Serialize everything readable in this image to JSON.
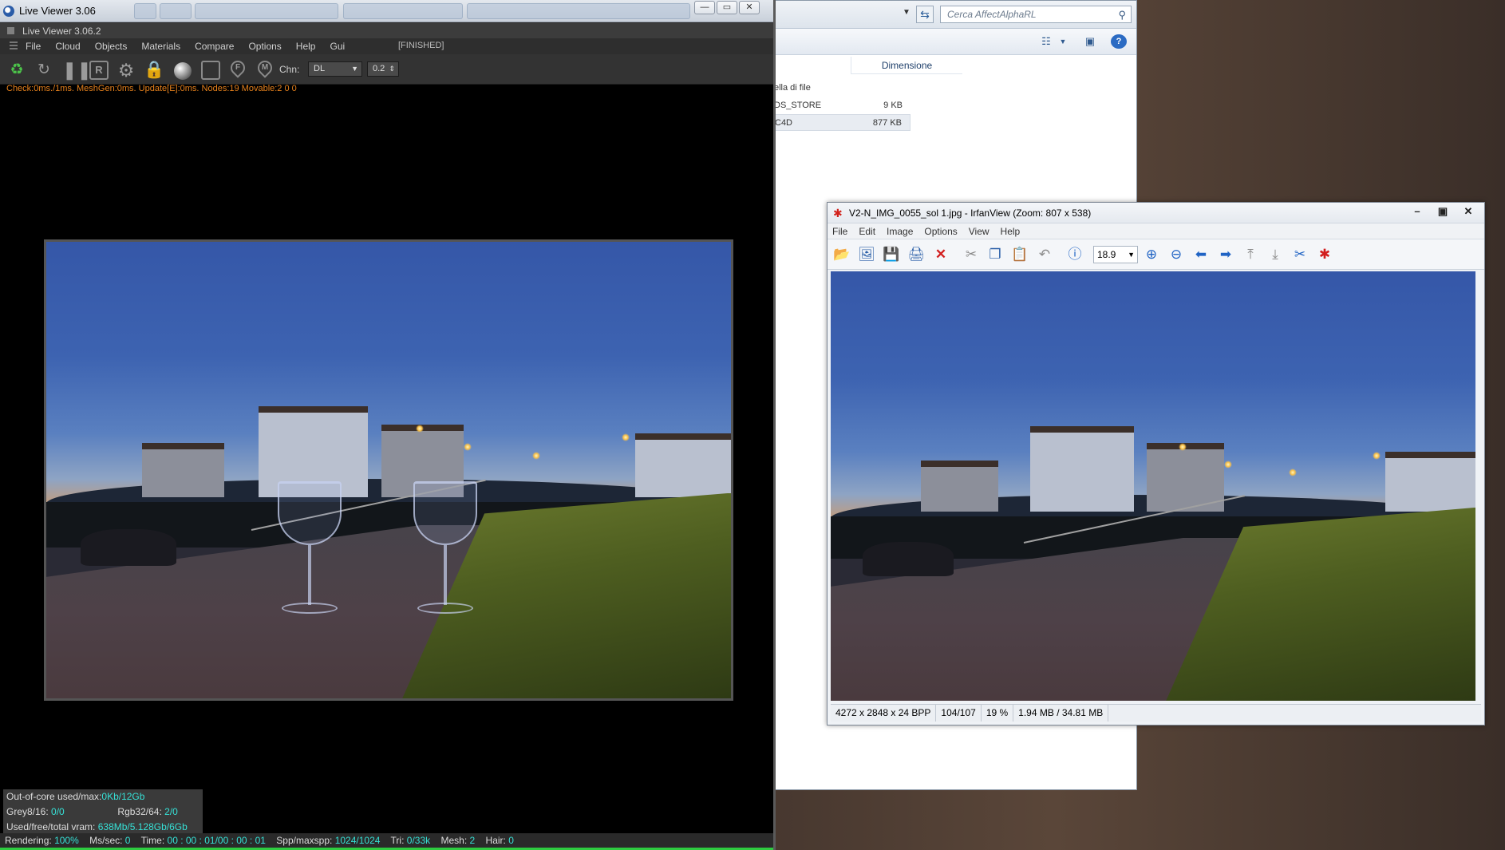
{
  "explorer": {
    "search_placeholder": "Cerca AffectAlphaRL",
    "column_header": "Dimensione",
    "partial_label": "ella di file",
    "files": [
      {
        "name": "DS_STORE",
        "size": "9 KB"
      },
      {
        "name": "C4D",
        "size": "877 KB"
      }
    ]
  },
  "liveviewer": {
    "window_title": "Live Viewer 3.06",
    "subtitle": "Live Viewer 3.06.2",
    "menu": [
      "File",
      "Cloud",
      "Objects",
      "Materials",
      "Compare",
      "Options",
      "Help",
      "Gui"
    ],
    "state": "[FINISHED]",
    "channel_label": "Chn:",
    "channel_value": "DL",
    "param_value": "0.2",
    "status_line": "Check:0ms./1ms. MeshGen:0ms. Update[E]:0ms. Nodes:19 Movable:2  0 0",
    "toolbar_icons": [
      "recycle-icon",
      "refresh-icon",
      "pause-icon",
      "region-render-icon",
      "settings-gear-icon",
      "lock-icon",
      "material-sphere-icon",
      "crop-icon",
      "focus-pin-icon",
      "material-pin-icon"
    ],
    "stats": {
      "ooc_label": "Out-of-core used/max:",
      "ooc_value": "0Kb/12Gb",
      "grey_label": "Grey8/16:",
      "grey_value": "0/0",
      "rgb_label": "Rgb32/64:",
      "rgb_value": "2/0",
      "vram_label": "Used/free/total vram:",
      "vram_value": "638Mb/5.128Gb/6Gb"
    },
    "bottom": {
      "rendering_label": "Rendering:",
      "rendering_value": "100%",
      "mssec_label": "Ms/sec:",
      "mssec_value": "0",
      "time_label": "Time:",
      "time_value": "00 : 00 : 01/00 : 00 : 01",
      "spp_label": "Spp/maxspp:",
      "spp_value": "1024/1024",
      "tri_label": "Tri:",
      "tri_value": "0/33k",
      "mesh_label": "Mesh:",
      "mesh_value": "2",
      "hair_label": "Hair:",
      "hair_value": "0"
    }
  },
  "irfanview": {
    "title": "V2-N_IMG_0055_sol 1.jpg - IrfanView (Zoom: 807 x 538)",
    "menu": [
      "File",
      "Edit",
      "Image",
      "Options",
      "View",
      "Help"
    ],
    "zoom_value": "18.9",
    "status": [
      "4272 x 2848 x 24 BPP",
      "104/107",
      "19 %",
      "1.94 MB / 34.81 MB"
    ]
  },
  "colors": {
    "status_orange": "#e8821c",
    "stats_cyan": "#36e0d6",
    "render_done_green": "#2ecc40"
  }
}
